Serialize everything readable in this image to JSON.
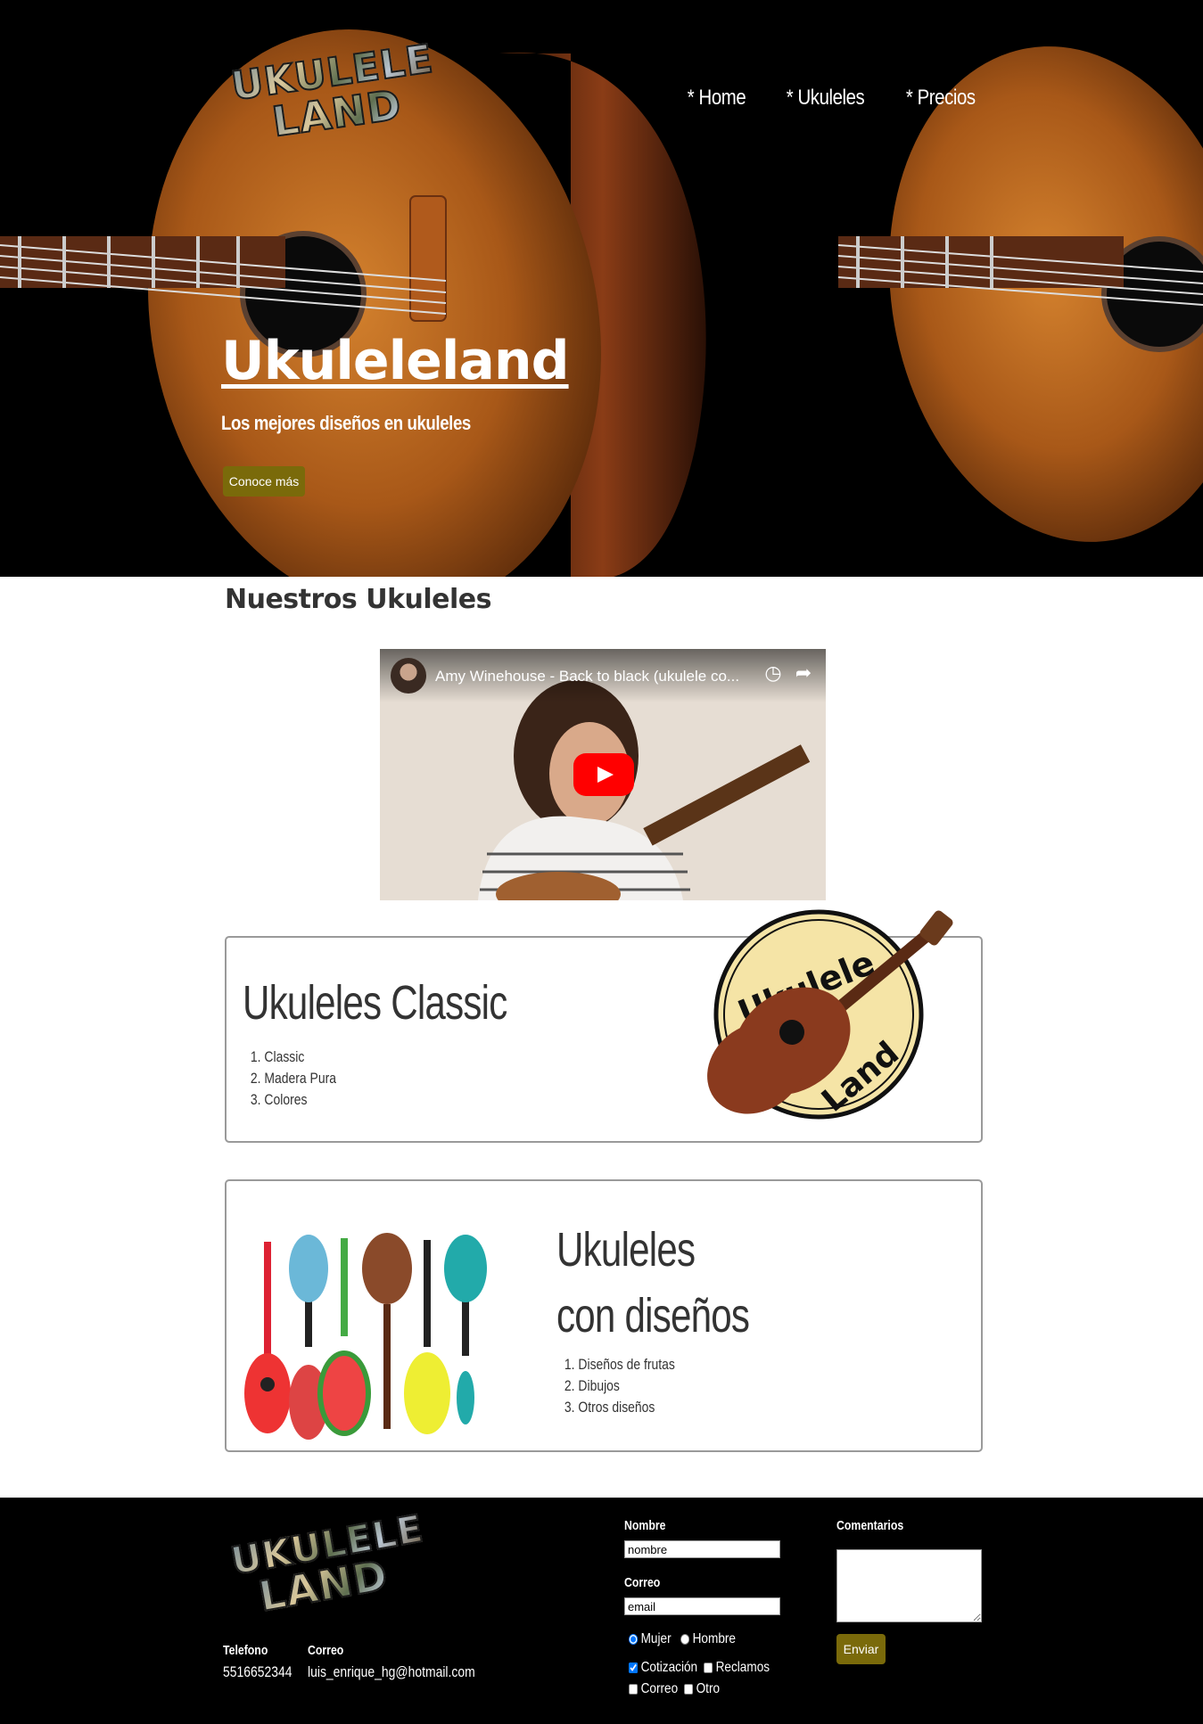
{
  "brand": {
    "logo_line1": "UKULELE",
    "logo_line2": "LAND"
  },
  "nav": {
    "items": [
      "* Home",
      "* Ukuleles",
      "* Precios"
    ]
  },
  "hero": {
    "title": "Ukuleleland",
    "subtitle": "Los mejores diseños en ukuleles",
    "cta_label": "Conoce más"
  },
  "section": {
    "title": "Nuestros Ukuleles"
  },
  "video": {
    "title": "Amy Winehouse - Back to black (ukulele co...",
    "watch_later_icon": "clock-icon",
    "share_icon": "share-icon"
  },
  "card1": {
    "title": "Ukuleles Classic",
    "items": [
      "Classic",
      "Madera Pura",
      "Colores"
    ],
    "badge_word1": "Ukulele",
    "badge_word2": "Land"
  },
  "card2": {
    "title_line1": "Ukuleles",
    "title_line2": "con diseños",
    "items": [
      "Diseños de frutas",
      "Dibujos",
      "Otros diseños"
    ]
  },
  "footer": {
    "phone_label": "Telefono",
    "phone_value": "5516652344",
    "email_label": "Correo",
    "email_value": "luis_enrique_hg@hotmail.com",
    "form": {
      "name_label": "Nombre",
      "name_value": "nombre",
      "email_label": "Correo",
      "email_value": "email",
      "comments_label": "Comentarios",
      "gender_options": [
        "Mujer",
        "Hombre"
      ],
      "gender_selected": "Mujer",
      "topic_options": [
        "Cotización",
        "Reclamos",
        "Correo",
        "Otro"
      ],
      "topic_checked": [
        "Cotización"
      ],
      "submit_label": "Enviar"
    }
  },
  "colors": {
    "accent": "#7a6a0a",
    "footer_bg": "#000000",
    "hero_bg": "#000000"
  }
}
